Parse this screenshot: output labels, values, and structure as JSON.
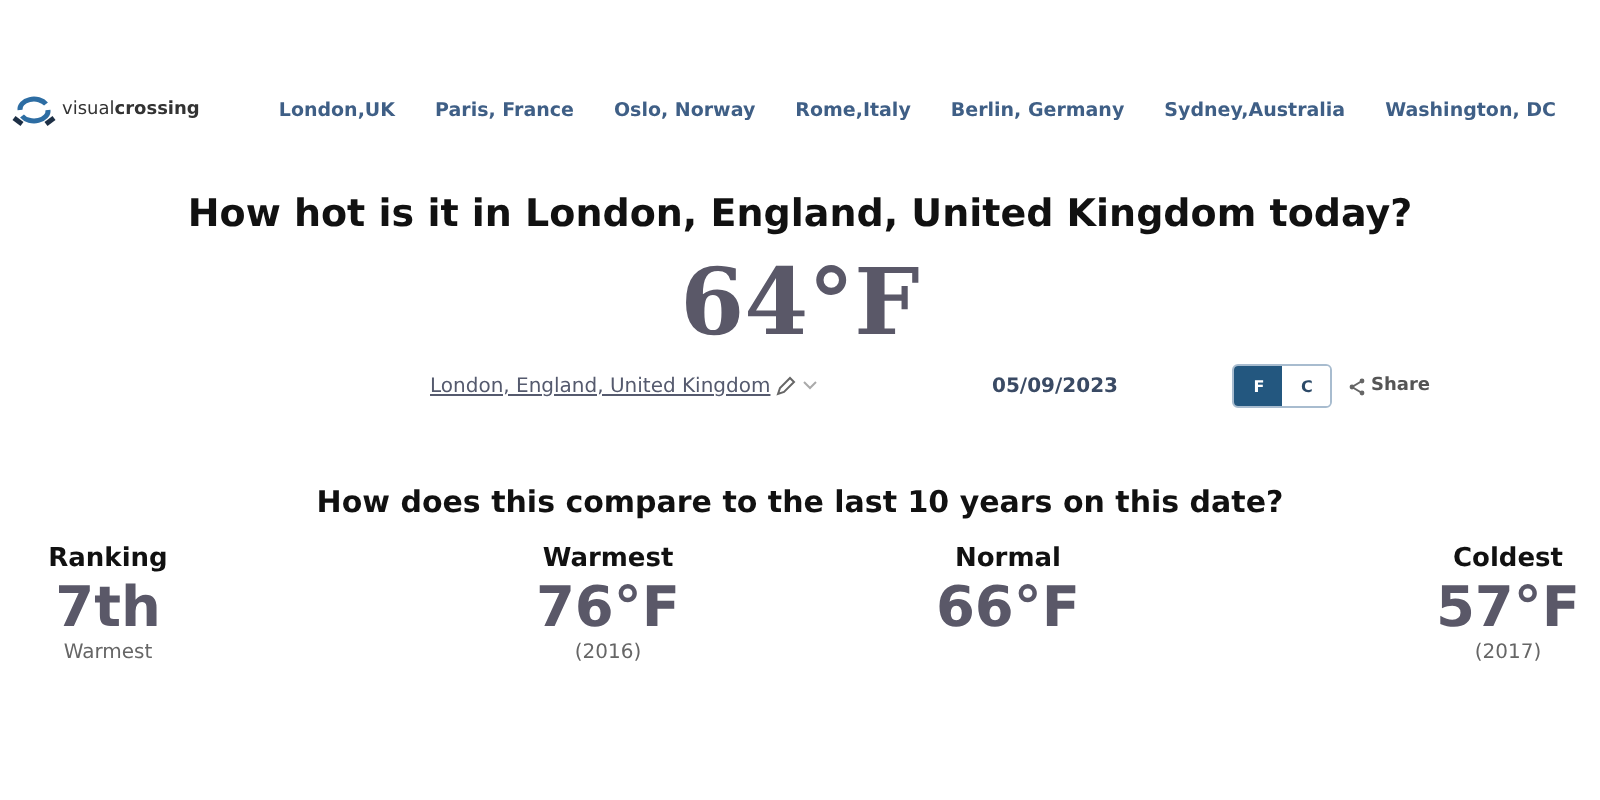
{
  "logo": {
    "text": "visual**crossing**"
  },
  "nav": [
    {
      "label": "London,UK"
    },
    {
      "label": "Paris, France"
    },
    {
      "label": "Oslo, Norway"
    },
    {
      "label": "Rome,Italy"
    },
    {
      "label": "Berlin, Germany"
    },
    {
      "label": "Sydney,Australia"
    },
    {
      "label": "Washington, DC"
    }
  ],
  "heading": "How hot is it in London, England, United Kingdom today?",
  "temperature": "64°F",
  "location": "London, England, United Kingdom",
  "date": "05/09/2023",
  "units": [
    {
      "label": "F",
      "selected": true
    },
    {
      "label": "C",
      "selected": false
    }
  ],
  "share": "Share",
  "compare_heading": "How does this compare to the last 10 years on this date?",
  "stats": [
    {
      "label": "Ranking",
      "value": "7th",
      "note": "Warmest"
    },
    {
      "label": "Warmest",
      "value": "76°F",
      "note": "(2016)"
    },
    {
      "label": "Normal",
      "value": "66°F"
    },
    {
      "label": "Coldest",
      "value": "57°F",
      "note": "(2017)"
    }
  ]
}
